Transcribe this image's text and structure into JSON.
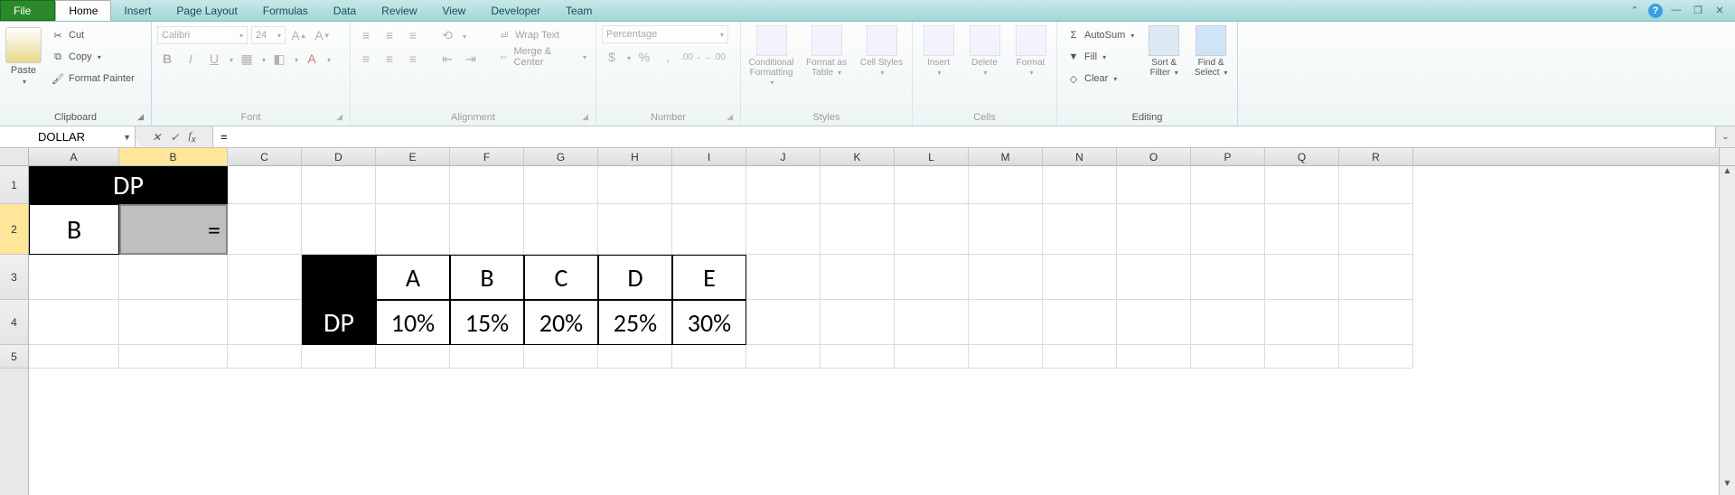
{
  "tabs": {
    "file": "File",
    "list": [
      "Home",
      "Insert",
      "Page Layout",
      "Formulas",
      "Data",
      "Review",
      "View",
      "Developer",
      "Team"
    ],
    "active": "Home"
  },
  "clipboard": {
    "paste": "Paste",
    "cut": "Cut",
    "copy": "Copy",
    "fmtpainter": "Format Painter",
    "label": "Clipboard"
  },
  "font": {
    "name": "Calibri",
    "size": "24",
    "bold": "B",
    "italic": "I",
    "underline": "U",
    "label": "Font"
  },
  "alignment": {
    "wrap": "Wrap Text",
    "merge": "Merge & Center",
    "label": "Alignment"
  },
  "number": {
    "format": "Percentage",
    "dollar": "$",
    "percent": "%",
    "comma": ",",
    "label": "Number"
  },
  "styles": {
    "cond": "Conditional Formatting",
    "table": "Format as Table",
    "cell": "Cell Styles",
    "label": "Styles"
  },
  "cellsgrp": {
    "insert": "Insert",
    "delete": "Delete",
    "format": "Format",
    "label": "Cells"
  },
  "editing": {
    "autosum": "AutoSum",
    "fill": "Fill",
    "clear": "Clear",
    "sort": "Sort & Filter",
    "find": "Find & Select",
    "label": "Editing"
  },
  "fx": {
    "name": "DOLLAR",
    "formula": "="
  },
  "cols": [
    "A",
    "B",
    "C",
    "D",
    "E",
    "F",
    "G",
    "H",
    "I",
    "J",
    "K",
    "L",
    "M",
    "N",
    "O",
    "P",
    "Q",
    "R"
  ],
  "rows": [
    "1",
    "2",
    "3",
    "4",
    "5"
  ],
  "colw": {
    "A": 100,
    "B": 120,
    "default": 82
  },
  "rowh": {
    "r1": 42,
    "r2": 56,
    "r3": 50,
    "r4": 50,
    "r5": 26
  },
  "sheet": {
    "a1b1": "DP",
    "a2": "B",
    "b2": "=",
    "d4": "DP",
    "e3": "A",
    "f3": "B",
    "g3": "C",
    "h3": "D",
    "i3": "E",
    "e4": "10%",
    "f4": "15%",
    "g4": "20%",
    "h4": "25%",
    "i4": "30%"
  },
  "chart_data": {
    "type": "table",
    "title": "DP",
    "categories": [
      "A",
      "B",
      "C",
      "D",
      "E"
    ],
    "values": [
      0.1,
      0.15,
      0.2,
      0.25,
      0.3
    ]
  }
}
